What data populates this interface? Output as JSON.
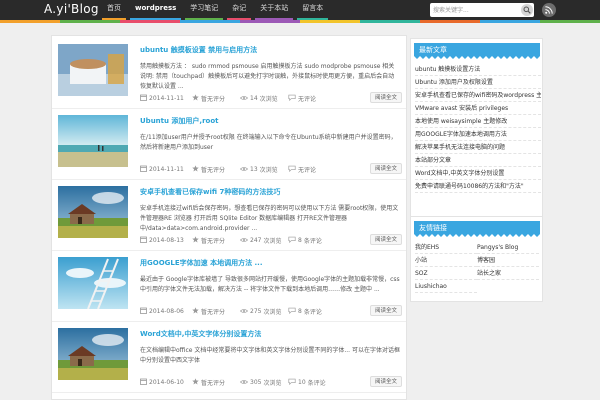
{
  "site": {
    "logo": "A.yi'Blog"
  },
  "colors": {
    "strip": [
      "#f2a02b",
      "#5fb14b",
      "#e84d6b",
      "#3aa6e0",
      "#9c59b6",
      "#f2c42b",
      "#30b59b",
      "#e86a2b",
      "#3aa6e0",
      "#5fb14b"
    ]
  },
  "nav": [
    {
      "label": "首页",
      "active": false,
      "color": "#f2a02b"
    },
    {
      "label": "wordpress",
      "active": true,
      "color": "#3aa6e0"
    },
    {
      "label": "学习笔记",
      "active": false,
      "color": "#5fb14b"
    },
    {
      "label": "杂记",
      "active": false,
      "color": "#e84d6b"
    },
    {
      "label": "关于本站",
      "active": false,
      "color": "#9c59b6"
    },
    {
      "label": "留言本",
      "active": false,
      "color": "#30b59b"
    }
  ],
  "search": {
    "placeholder": "搜索关键字...",
    "icon": "search-icon"
  },
  "rss": {
    "icon": "rss-icon"
  },
  "posts": [
    {
      "title": "ubuntu 触摸板设置 禁用与启用方法",
      "excerpt": "禁用触摸板方法 ： sudo rmmod psmouse 启用触摸板方法 sudo modprobe psmouse 相关说明: 禁用（touchpad）触摸板后可以避免打字时误触，外接鼠标时使用更方便，重启后会自动恢复默认设置 ...",
      "date": "2014-11-11",
      "rate": "暂无评分",
      "views": "14",
      "views_unit": "次浏览",
      "comments": "无评论",
      "more": "阅读全文",
      "thumb": "cup"
    },
    {
      "title": "Ubuntu 添加用户,root",
      "excerpt": "在/11添加user用户并授予root权限\n在终端输入以下命令在Ubuntu系统中新建用户并设置密码，然后将新建用户添加到user",
      "date": "2014-11-11",
      "rate": "暂无评分",
      "views": "13",
      "views_unit": "次浏览",
      "comments": "无评论",
      "more": "阅读全文",
      "thumb": "beach"
    },
    {
      "title": "安卓手机查看已保存wifi 7种密码的方法技巧",
      "excerpt": "安卓手机连接过wifi后会保存密码，想查看已保存的密码可以使用以下方法 需要root权限，使用文件管理器RE 浏览器 打开后用 SQlite Editor 数据库编辑器 打开RE文件管理器中/data>data>com.android.provider ...",
      "date": "2014-08-13",
      "rate": "暂无评分",
      "views": "247",
      "views_unit": "次浏览",
      "comments": "8",
      "comments_unit": "条评论",
      "more": "阅读全文",
      "thumb": "house"
    },
    {
      "title": "用GOOGLE字体加速 本地调用方法 ...",
      "excerpt": "最近由于 Google字体库被墙了 导致很多网站打开缓慢，使用Google字体的主题加载非常慢，css 中引用的字体文件无法加载，解决方法 -- 将字体文件下载到本地后调用……修改 主题中 ...",
      "date": "2014-08-06",
      "rate": "暂无评分",
      "views": "275",
      "views_unit": "次浏览",
      "comments": "8",
      "comments_unit": "条评论",
      "more": "阅读全文",
      "thumb": "ladder"
    },
    {
      "title": "Word文档中,中英文字体分别设置方法",
      "excerpt": "在文档编辑中office 文档中经常要将中文字体和英文字体分别设置不同的字体...\n可以在字体对话框中分别设置中西文字体",
      "date": "2014-06-10",
      "rate": "暂无评分",
      "views": "305",
      "views_unit": "次浏览",
      "comments": "10",
      "comments_unit": "条评论",
      "more": "阅读全文",
      "thumb": "house"
    }
  ],
  "sidebar": {
    "recent": {
      "title": "最新文章",
      "items": [
        "ubuntu 触摸板设置方法",
        "Ubuntu 添加用户及权限设置",
        "安卓手机查看已保存的wifi密码及wordpress 主题的方法",
        "VMware avast 安装后 privileges",
        "本地使用 weisaysimple 主题修改",
        "用GOOGLE字体加速本地调用方法",
        "解决苹果手机无法连接电脑的问题",
        "本站部分文章",
        "Word文档中,中英文字体分别设置",
        "免费申请联通号码10086的方法和\"方法\""
      ]
    },
    "links": {
      "title": "友情链接",
      "items": [
        "我的EHS",
        "Pangys's Blog",
        "小站",
        "博客园",
        "SOZ",
        "站长之家",
        "Liushichao"
      ]
    }
  }
}
